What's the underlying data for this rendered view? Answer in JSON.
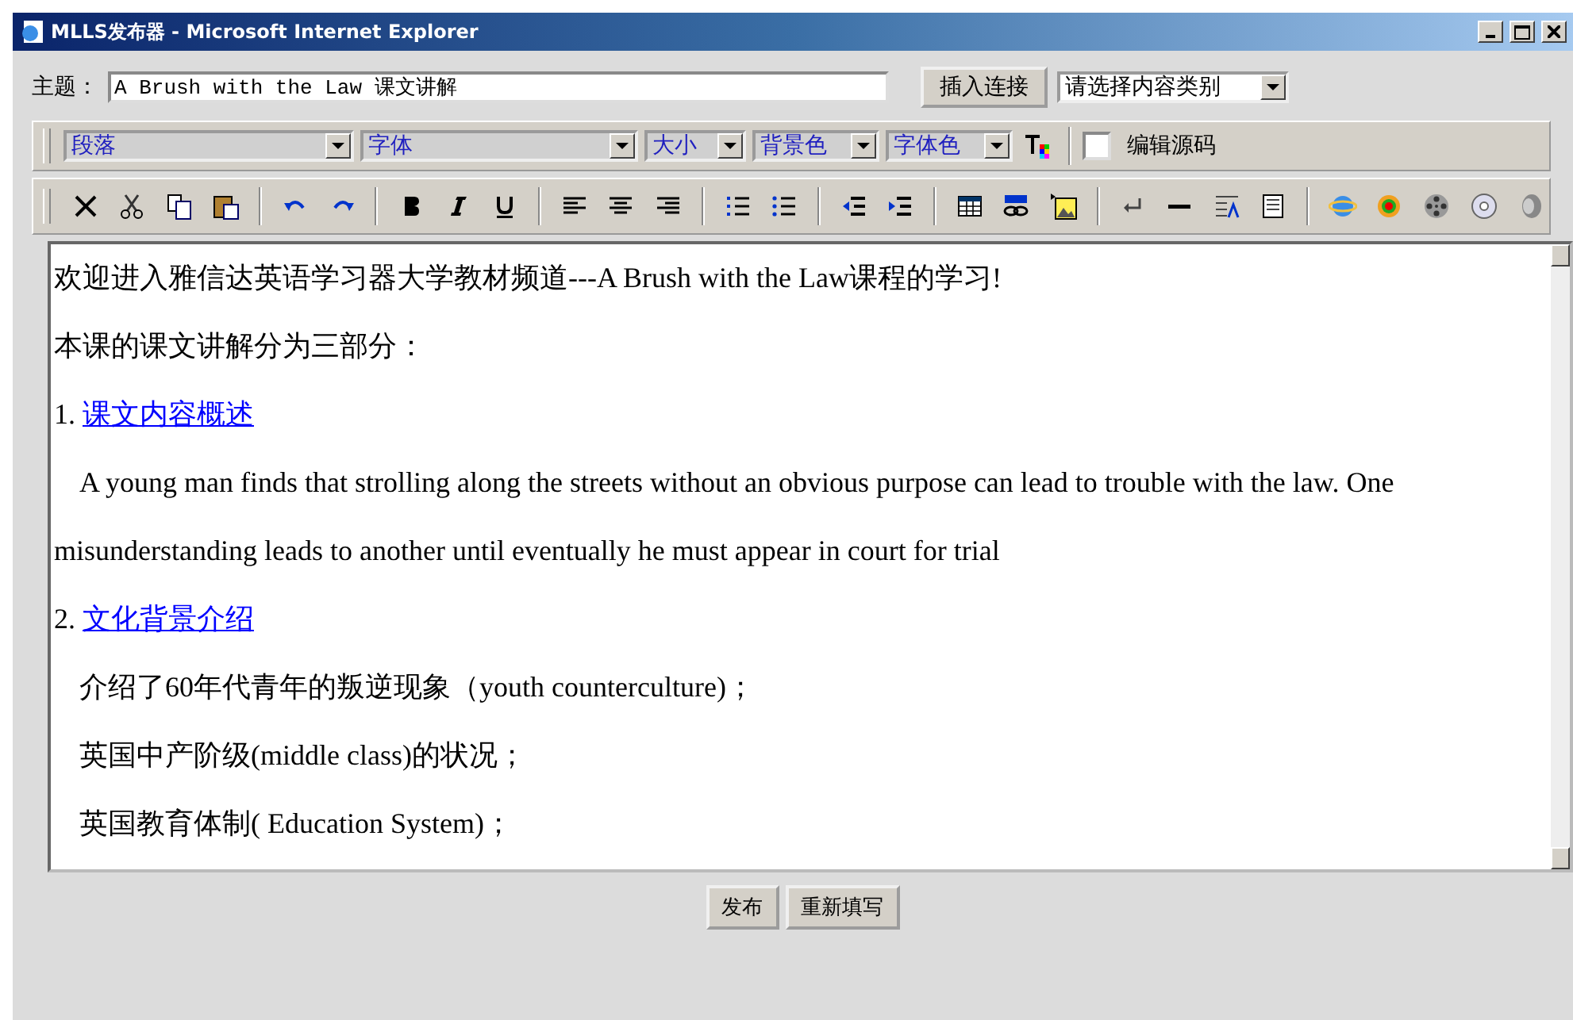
{
  "window": {
    "title": "MLLS发布器 - Microsoft Internet Explorer"
  },
  "subject": {
    "label": "主题：",
    "value": "A Brush with the Law 课文讲解"
  },
  "insert_link_button": "插入连接",
  "category_select": {
    "value": "请选择内容类别"
  },
  "format_selects": [
    {
      "value": "段落"
    },
    {
      "value": "字体"
    },
    {
      "value": "大小"
    },
    {
      "value": "背景色"
    },
    {
      "value": "字体色"
    }
  ],
  "edit_source": {
    "label": "编辑源码",
    "checked": false
  },
  "content": [
    {
      "kind": "text",
      "text": "欢迎进入雅信达英语学习器大学教材频道---A Brush with the Law课程的学习!"
    },
    {
      "kind": "text",
      "text": "本课的课文讲解分为三部分："
    },
    {
      "kind": "section",
      "number": "1.",
      "link": "课文内容概述"
    },
    {
      "kind": "indent",
      "text": "A young man finds that strolling along the streets without an obvious purpose can lead to trouble with the law. One misunderstanding leads to another until eventually he must appear in court for trial"
    },
    {
      "kind": "section",
      "number": "2.",
      "link": "文化背景介绍"
    },
    {
      "kind": "indent",
      "text": "介绍了60年代青年的叛逆现象（youth counterculture)；"
    },
    {
      "kind": "indent",
      "text": "英国中产阶级(middle class)的状况；"
    },
    {
      "kind": "indent",
      "text": "英国教育体制( Education System)；"
    }
  ],
  "buttons": [
    "发布",
    "重新填写"
  ]
}
